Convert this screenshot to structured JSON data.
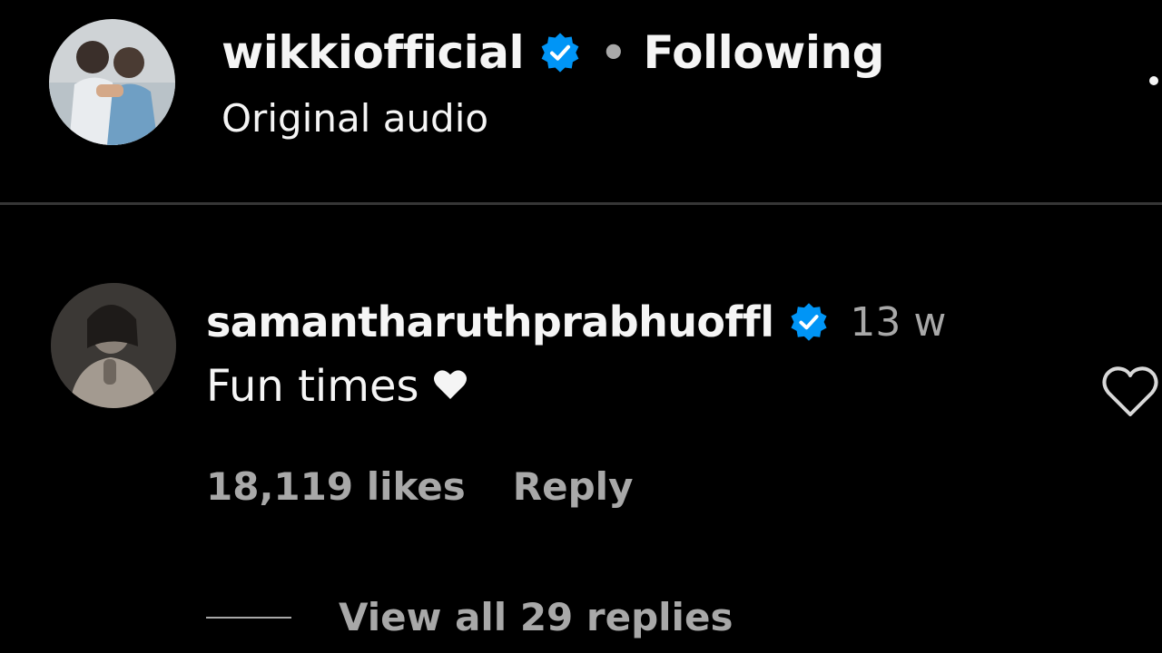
{
  "post_header": {
    "author": "wikkiofficial",
    "separator": "•",
    "follow_state": "Following",
    "audio": "Original audio"
  },
  "comment": {
    "username": "samantharuthprabhuoffl",
    "time_ago": "13 w",
    "text": "Fun times",
    "likes": "18,119 likes",
    "reply_label": "Reply",
    "view_replies": "View all 29 replies"
  },
  "colors": {
    "background": "#000000",
    "primary_text": "#f5f5f5",
    "secondary_text": "#a8a8a8",
    "verified_badge": "#0095f6",
    "divider": "#363636"
  },
  "icons": {
    "verified": "verified-badge-icon",
    "like": "heart-outline-icon",
    "emoji": "white-heart-emoji-icon",
    "more": "more-options-icon"
  }
}
